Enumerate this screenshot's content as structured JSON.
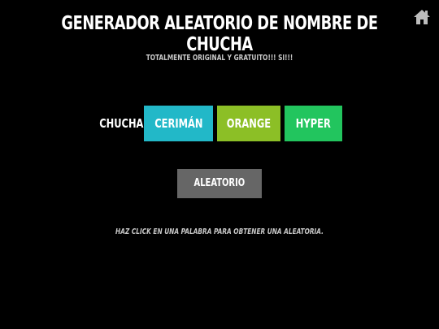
{
  "header": {
    "title": "GENERADOR ALEATORIO DE NOMBRE DE CHUCHA",
    "subtitle": "TOTALMENTE ORIGINAL Y GRATUITO!!! SI!!!"
  },
  "generator": {
    "prefix": "CHUCHA",
    "words": [
      {
        "label": "CERIMÁN",
        "color": "#22b8c8"
      },
      {
        "label": "ORANGE",
        "color": "#8cbf26"
      },
      {
        "label": "HYPER",
        "color": "#22c55e"
      }
    ],
    "random_label": "ALEATORIO",
    "hint": "HAZ CLICK EN UNA PALABRA PARA OBTENER UNA ALEATORIA."
  },
  "icons": {
    "home": "home-icon"
  },
  "colors": {
    "background": "#000000",
    "button_gray": "#666666",
    "hint_gray": "#c8c8c8"
  }
}
